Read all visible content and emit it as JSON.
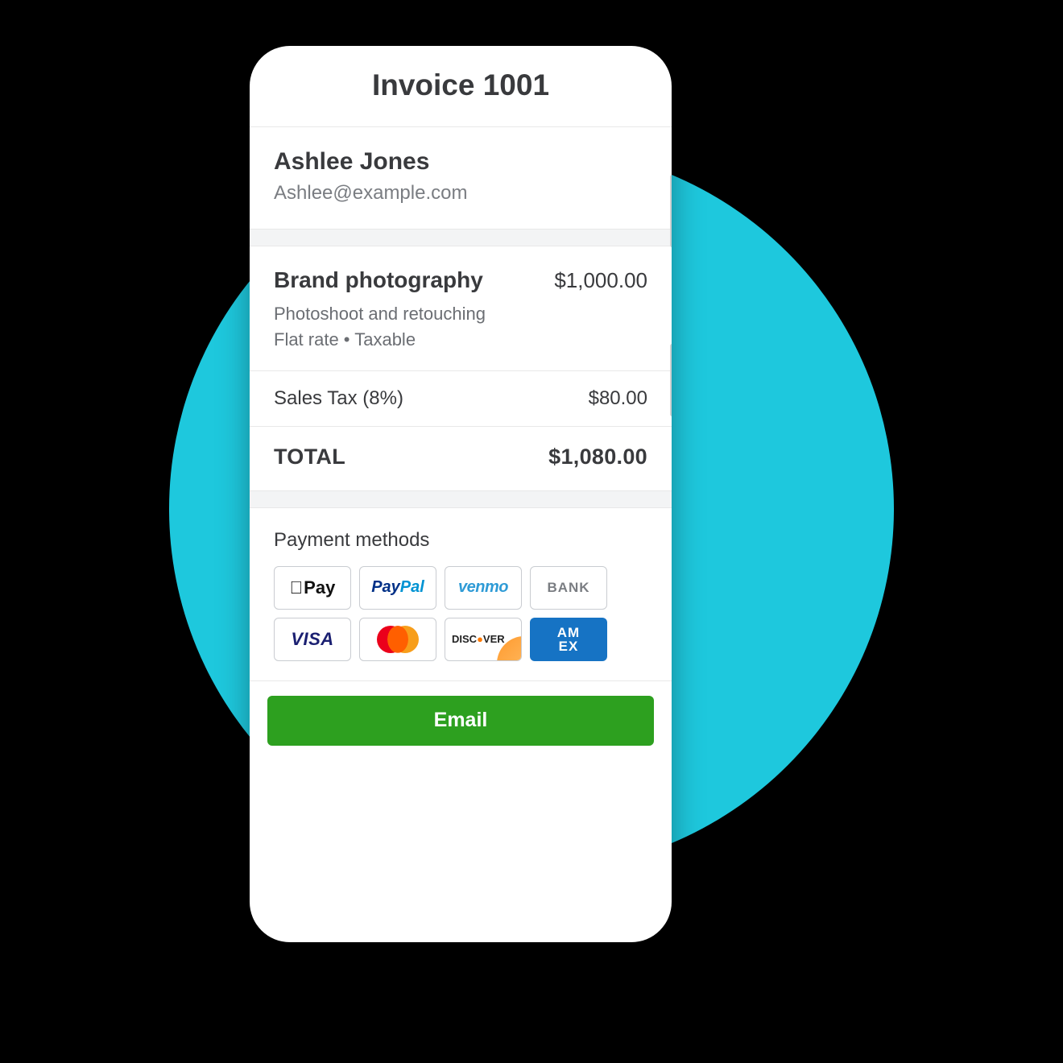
{
  "header": {
    "title": "Invoice 1001"
  },
  "customer": {
    "name": "Ashlee Jones",
    "email": "Ashlee@example.com"
  },
  "line_item": {
    "name": "Brand photography",
    "amount": "$1,000.00",
    "description": "Photoshoot and retouching",
    "terms": "Flat rate • Taxable"
  },
  "tax": {
    "label": "Sales Tax (8%)",
    "amount": "$80.00"
  },
  "total": {
    "label": "TOTAL",
    "amount": "$1,080.00"
  },
  "payments": {
    "heading": "Payment methods",
    "methods": {
      "apple_pay": "Pay",
      "paypal_a": "Pay",
      "paypal_b": "Pal",
      "venmo": "venmo",
      "bank": "BANK",
      "visa": "VISA",
      "discover_a": "DISC",
      "discover_b": "VER",
      "amex_a": "AM",
      "amex_b": "EX"
    }
  },
  "actions": {
    "email": "Email"
  }
}
